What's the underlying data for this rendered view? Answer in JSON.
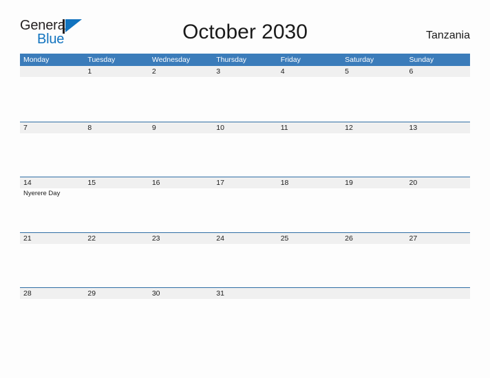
{
  "brand": {
    "name_part1": "General",
    "name_part2": "Blue",
    "flag_icon": "blue-triangle-flag",
    "color_dark": "#231f20",
    "color_blue": "#1173bf"
  },
  "header": {
    "title": "October 2030",
    "country": "Tanzania"
  },
  "theme": {
    "header_blue": "#3b7cba",
    "row_rule": "#2e6da4",
    "day_band": "#f0f0f0",
    "page_background": "#fdfdfd",
    "text": "#1a1a1a"
  },
  "calendar": {
    "month": "October",
    "year": "2030",
    "weekday_headers": [
      "Monday",
      "Tuesday",
      "Wednesday",
      "Thursday",
      "Friday",
      "Saturday",
      "Sunday"
    ],
    "weeks": [
      {
        "days": [
          {
            "num": "",
            "events": []
          },
          {
            "num": "1",
            "events": []
          },
          {
            "num": "2",
            "events": []
          },
          {
            "num": "3",
            "events": []
          },
          {
            "num": "4",
            "events": []
          },
          {
            "num": "5",
            "events": []
          },
          {
            "num": "6",
            "events": []
          }
        ]
      },
      {
        "days": [
          {
            "num": "7",
            "events": []
          },
          {
            "num": "8",
            "events": []
          },
          {
            "num": "9",
            "events": []
          },
          {
            "num": "10",
            "events": []
          },
          {
            "num": "11",
            "events": []
          },
          {
            "num": "12",
            "events": []
          },
          {
            "num": "13",
            "events": []
          }
        ]
      },
      {
        "days": [
          {
            "num": "14",
            "events": [
              "Nyerere Day"
            ]
          },
          {
            "num": "15",
            "events": []
          },
          {
            "num": "16",
            "events": []
          },
          {
            "num": "17",
            "events": []
          },
          {
            "num": "18",
            "events": []
          },
          {
            "num": "19",
            "events": []
          },
          {
            "num": "20",
            "events": []
          }
        ]
      },
      {
        "days": [
          {
            "num": "21",
            "events": []
          },
          {
            "num": "22",
            "events": []
          },
          {
            "num": "23",
            "events": []
          },
          {
            "num": "24",
            "events": []
          },
          {
            "num": "25",
            "events": []
          },
          {
            "num": "26",
            "events": []
          },
          {
            "num": "27",
            "events": []
          }
        ]
      },
      {
        "days": [
          {
            "num": "28",
            "events": []
          },
          {
            "num": "29",
            "events": []
          },
          {
            "num": "30",
            "events": []
          },
          {
            "num": "31",
            "events": []
          },
          {
            "num": "",
            "events": []
          },
          {
            "num": "",
            "events": []
          },
          {
            "num": "",
            "events": []
          }
        ]
      }
    ]
  }
}
